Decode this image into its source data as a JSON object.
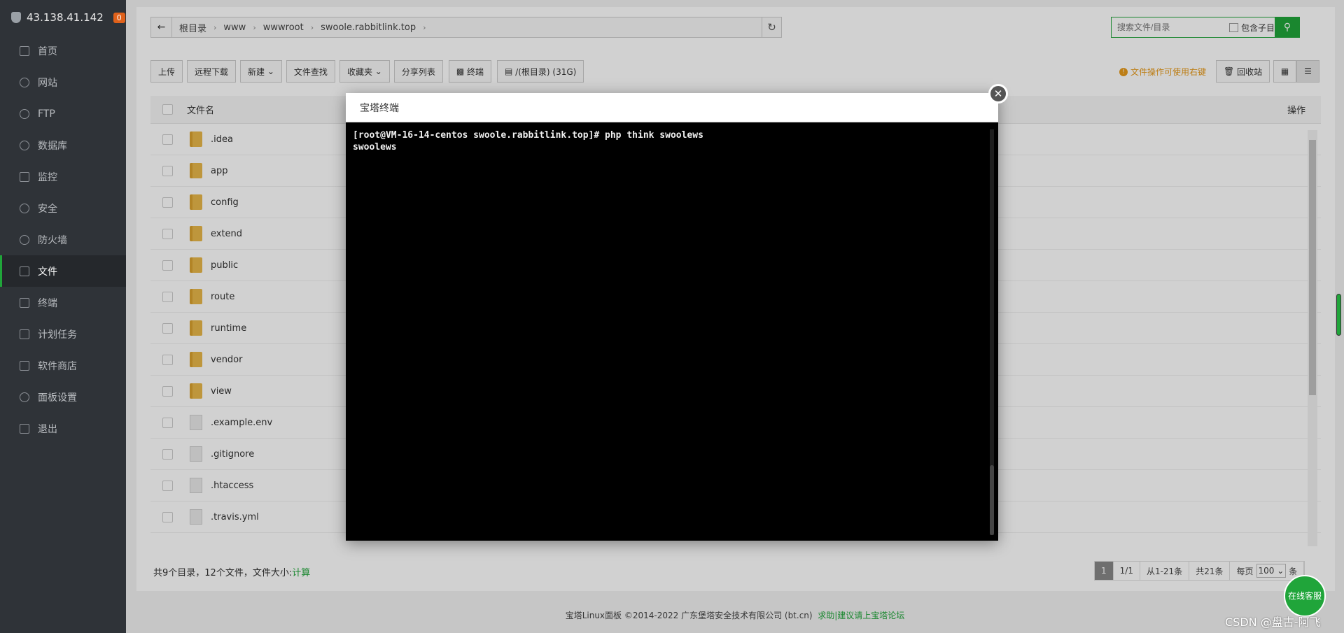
{
  "sidebar": {
    "ip": "43.138.41.142",
    "badge": "0",
    "items": [
      {
        "label": "首页"
      },
      {
        "label": "网站"
      },
      {
        "label": "FTP"
      },
      {
        "label": "数据库"
      },
      {
        "label": "监控"
      },
      {
        "label": "安全"
      },
      {
        "label": "防火墙"
      },
      {
        "label": "文件"
      },
      {
        "label": "终端"
      },
      {
        "label": "计划任务"
      },
      {
        "label": "软件商店"
      },
      {
        "label": "面板设置"
      },
      {
        "label": "退出"
      }
    ],
    "active_item": "文件"
  },
  "pathbar": {
    "crumbs": [
      "根目录",
      "www",
      "wwwroot",
      "swoole.rabbitlink.top"
    ]
  },
  "search": {
    "placeholder": "搜索文件/目录",
    "include_sub_label": "包含子目录"
  },
  "toolbar": {
    "upload": "上传",
    "remote_download": "远程下载",
    "new": "新建",
    "file_search": "文件查找",
    "favorites": "收藏夹",
    "share_list": "分享列表",
    "terminal": "终端",
    "disk": "/(根目录) (31G)",
    "tip": "文件操作可使用右键",
    "recycle": "回收站"
  },
  "table": {
    "col_name": "文件名",
    "col_op": "操作",
    "rows": [
      {
        "name": ".idea",
        "type": "folder"
      },
      {
        "name": "app",
        "type": "folder"
      },
      {
        "name": "config",
        "type": "folder"
      },
      {
        "name": "extend",
        "type": "folder"
      },
      {
        "name": "public",
        "type": "folder"
      },
      {
        "name": "route",
        "type": "folder"
      },
      {
        "name": "runtime",
        "type": "folder"
      },
      {
        "name": "vendor",
        "type": "folder"
      },
      {
        "name": "view",
        "type": "folder"
      },
      {
        "name": ".example.env",
        "type": "file"
      },
      {
        "name": ".gitignore",
        "type": "file"
      },
      {
        "name": ".htaccess",
        "type": "file"
      },
      {
        "name": ".travis.yml",
        "type": "file"
      }
    ]
  },
  "summary": {
    "text": "共9个目录，12个文件，文件大小:",
    "calc": "计算"
  },
  "pager": {
    "current": "1",
    "pages": "1/1",
    "range": "从1-21条",
    "total": "共21条",
    "per_page_label": "每页",
    "per_page_value": "100",
    "unit": "条"
  },
  "footer": {
    "copyright": "宝塔Linux面板 ©2014-2022 广东堡塔安全技术有限公司 (bt.cn)",
    "link": "求助|建议请上宝塔论坛"
  },
  "terminal_modal": {
    "title": "宝塔终端",
    "lines": [
      "[root@VM-16-14-centos swoole.rabbitlink.top]# php think swoolews",
      "swoolews"
    ]
  },
  "online_service": "在线客服",
  "watermark": "CSDN @盘古-阿飞"
}
